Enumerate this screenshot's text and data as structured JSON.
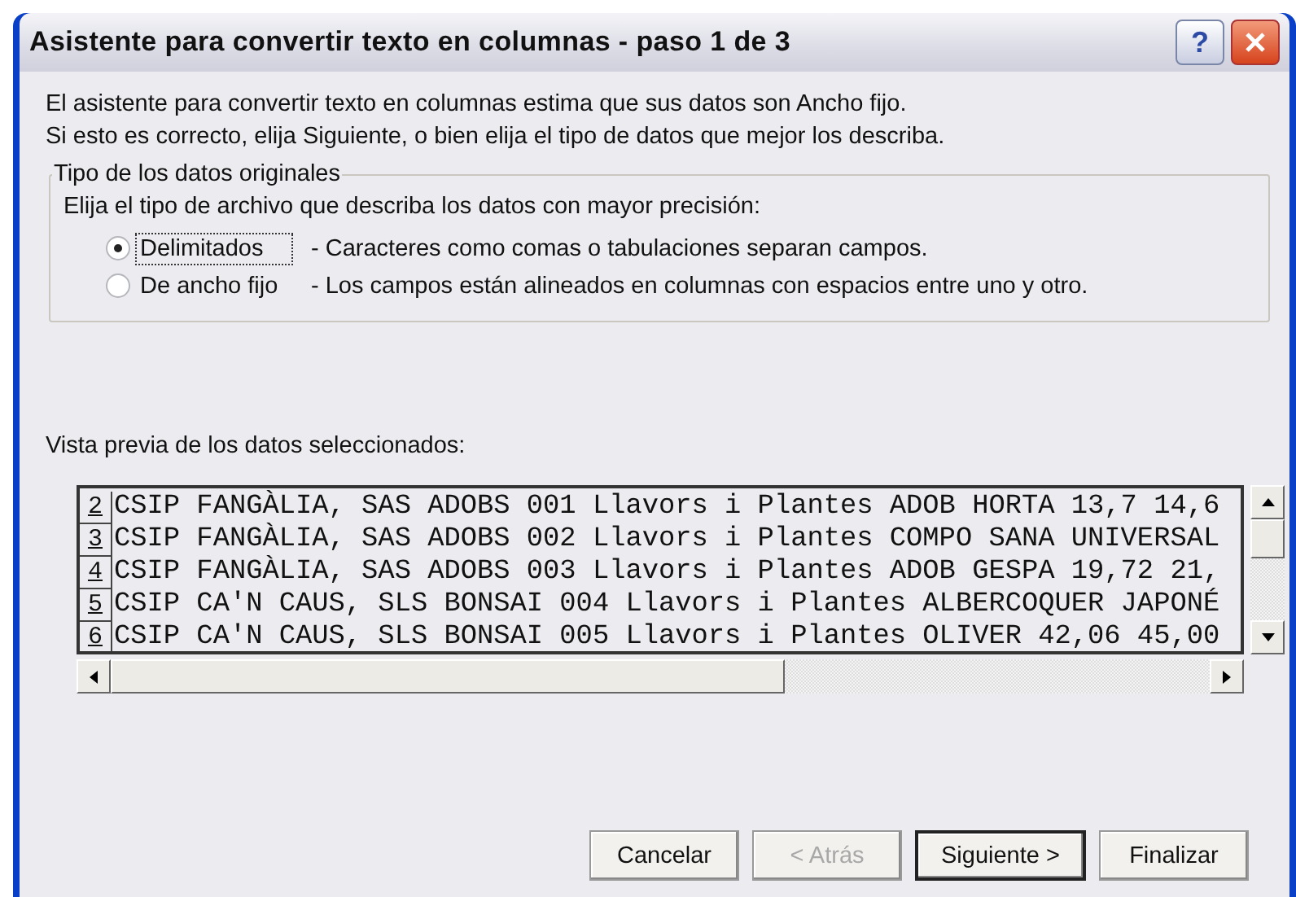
{
  "window": {
    "title": "Asistente para convertir texto en columnas - paso 1 de 3",
    "help": "?"
  },
  "intro": [
    "El asistente para convertir texto en columnas estima que sus datos son Ancho fijo.",
    "Si esto es correcto, elija Siguiente, o bien elija el tipo de datos que mejor los describa."
  ],
  "group": {
    "legend": "Tipo de los datos originales",
    "prompt": "Elija el tipo de archivo que describa los datos con mayor precisión:",
    "options": [
      {
        "label": "Delimitados",
        "description": "- Caracteres como comas o tabulaciones separan campos.",
        "selected": true,
        "focused": true
      },
      {
        "label": "De ancho fijo",
        "description": "- Los campos están alineados en columnas con espacios entre uno y otro.",
        "selected": false,
        "focused": false
      }
    ]
  },
  "preview": {
    "label": "Vista previa de los datos seleccionados:",
    "rows": [
      {
        "number": "2",
        "text": "CSIP FANGÀLIA, SAS ADOBS 001 Llavors i Plantes ADOB HORTA 13,7 14,6"
      },
      {
        "number": "3",
        "text": "CSIP FANGÀLIA, SAS ADOBS 002 Llavors i Plantes COMPO SANA UNIVERSAL"
      },
      {
        "number": "4",
        "text": "CSIP FANGÀLIA, SAS ADOBS 003 Llavors i Plantes ADOB GESPA 19,72 21,"
      },
      {
        "number": "5",
        "text": "CSIP CA'N CAUS, SLS BONSAI 004 Llavors i Plantes ALBERCOQUER JAPONÉ"
      },
      {
        "number": "6",
        "text": "CSIP CA'N CAUS, SLS BONSAI 005 Llavors i Plantes OLIVER 42,06 45,00"
      }
    ]
  },
  "buttons": [
    {
      "label": "Cancelar",
      "disabled": false,
      "default": false
    },
    {
      "label": "< Atrás",
      "disabled": true,
      "default": false
    },
    {
      "label": "Siguiente >",
      "disabled": false,
      "default": true
    },
    {
      "label": "Finalizar",
      "disabled": false,
      "default": false
    }
  ]
}
